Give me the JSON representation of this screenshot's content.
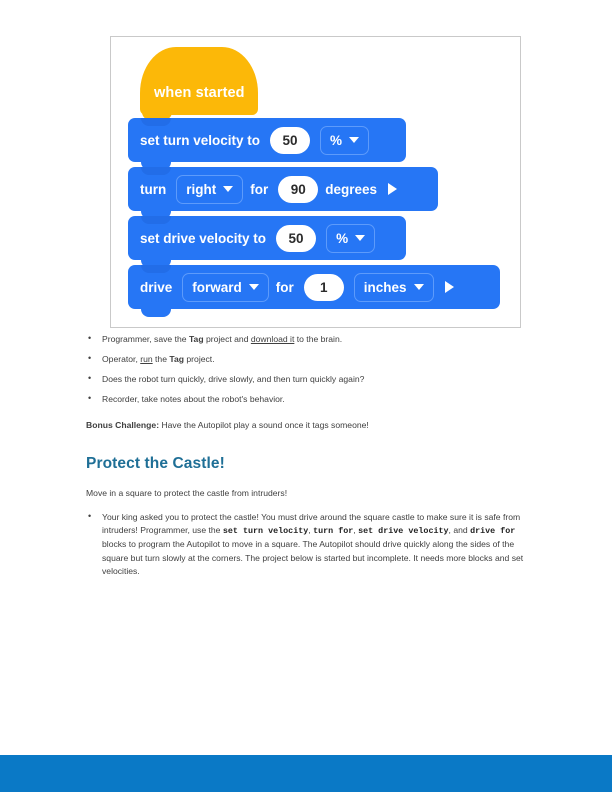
{
  "document": {
    "section_title": "Protect the Castle!",
    "lede": "Move in a square to protect the castle from intruders!"
  },
  "block_program": {
    "hat_block": {
      "label": "when started",
      "color": "#fcb808"
    },
    "block_color": "#2676f5",
    "blocks": [
      {
        "id": "set-turn-velocity",
        "label": "set turn velocity to",
        "value": "50",
        "unit": "%",
        "has_play": false
      },
      {
        "id": "turn",
        "label": "turn",
        "direction": "right",
        "for_label": "for",
        "value": "90",
        "unit": "degrees",
        "has_play": true
      },
      {
        "id": "set-drive-velocity",
        "label": "set drive velocity to",
        "value": "50",
        "unit": "%",
        "has_play": false
      },
      {
        "id": "drive",
        "label": "drive",
        "direction": "forward",
        "for_label": "for",
        "value": "1",
        "unit": "inches",
        "has_play": true
      }
    ]
  },
  "task_bullets": [
    {
      "p1": "Programmer, save the ",
      "b1": "Tag",
      "p2": " project and ",
      "link": "download it",
      "p3": " to the brain."
    },
    {
      "p1": "Operator, ",
      "link": "run",
      "p2": " the ",
      "b1": "Tag",
      "p3": " project."
    },
    {
      "p1": "Does the robot turn quickly, drive slowly, and then turn quickly again?"
    },
    {
      "p1": "Recorder, take notes about the robot's behavior."
    }
  ],
  "bonus": {
    "label": "Bonus Challenge:",
    "text": " Have the Autopilot play a sound once it tags someone!"
  },
  "castle_paragraph": {
    "s1": "Your king asked you to protect the castle! You must drive around the square castle to make sure it is safe from intruders! Programmer, use the ",
    "code1": "set turn velocity",
    "s2": ", ",
    "code2": "turn  for",
    "s3": ", ",
    "code3": "set drive velocity",
    "s4": ", and ",
    "code4": "drive  for",
    "s5": " blocks to program the Autopilot to move in a square. The Autopilot should drive quickly along the sides of the square but turn slowly at the corners. The project below is started but incomplete. It needs more blocks and set velocities."
  },
  "colors": {
    "heading": "#1f6f96",
    "footer_bar": "#0a79c6",
    "block_blue": "#2676f5",
    "hat_yellow": "#fcb808",
    "panel_border": "#c9c9c9"
  }
}
